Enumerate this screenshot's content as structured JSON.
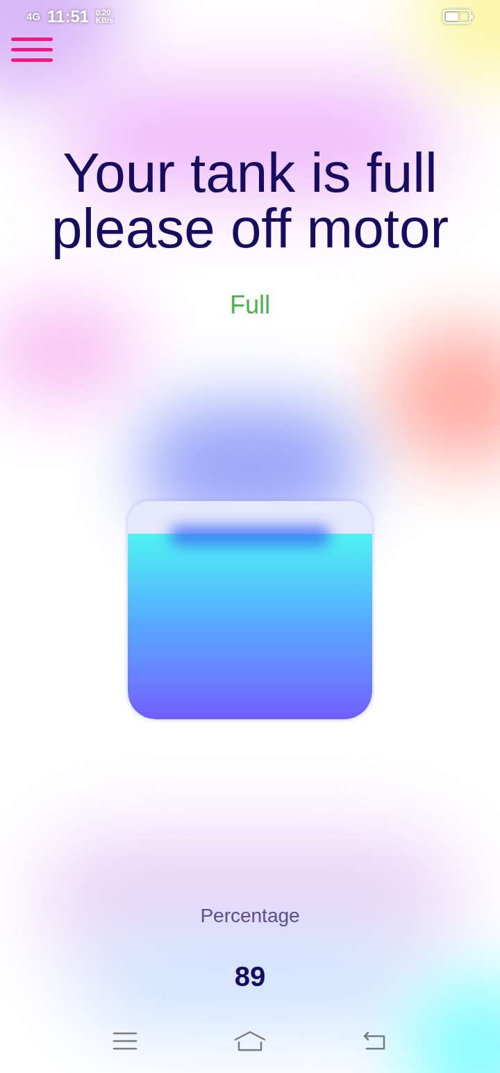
{
  "status_bar": {
    "network": "4G",
    "time": "11:51",
    "speed": "0.20",
    "speed_unit": "KB/s"
  },
  "title": "Your tank is full please off motor",
  "status": "Full",
  "tank": {
    "level": 0.85
  },
  "percentage": {
    "label": "Percentage",
    "value": "89"
  }
}
